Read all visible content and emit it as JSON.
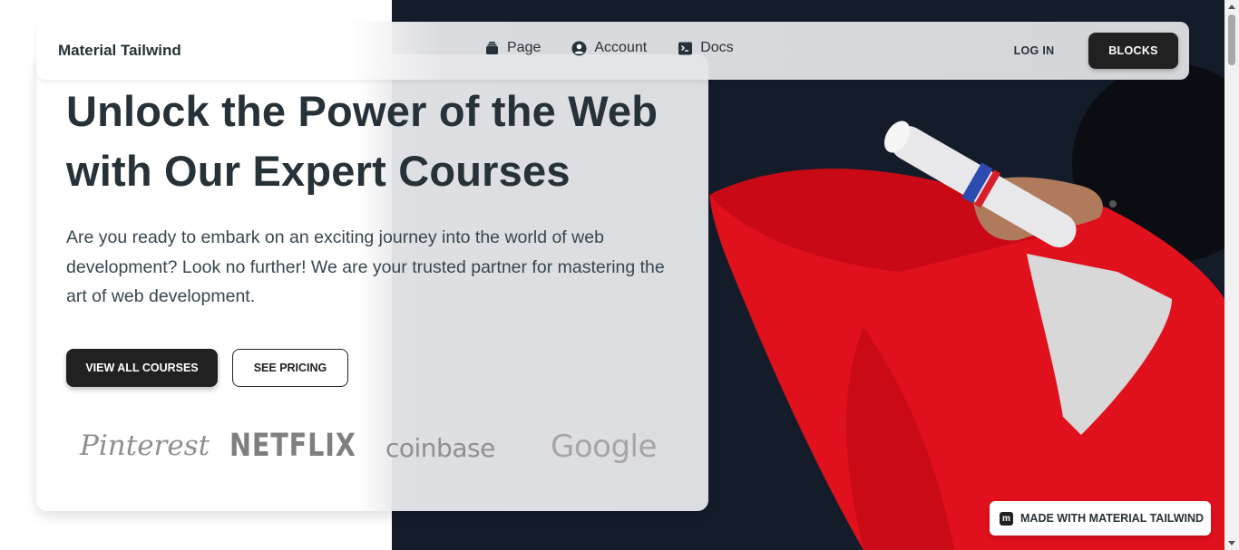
{
  "navbar": {
    "brand": "Material Tailwind",
    "links": [
      {
        "label": "Page",
        "icon": "rectangle-stack-icon"
      },
      {
        "label": "Account",
        "icon": "user-circle-icon"
      },
      {
        "label": "Docs",
        "icon": "command-line-icon"
      }
    ],
    "login_label": "LOG IN",
    "blocks_label": "BLOCKS"
  },
  "hero": {
    "title": "Unlock the Power of the Web with Our Expert Courses",
    "description": "Are you ready to embark on an exciting journey into the world of web development? Look no further! We are your trusted partner for mastering the art of web development.",
    "primary_button": "VIEW ALL COURSES",
    "secondary_button": "SEE PRICING",
    "logos": [
      "Pinterest",
      "NETFLIX",
      "coinbase",
      "Google"
    ]
  },
  "badge": {
    "label": "MADE WITH MATERIAL TAILWIND",
    "icon_letter": "m"
  },
  "colors": {
    "dark": "#212121",
    "text": "#263238",
    "photo_bg": "#141c2a",
    "gown_red": "#e0101c"
  }
}
